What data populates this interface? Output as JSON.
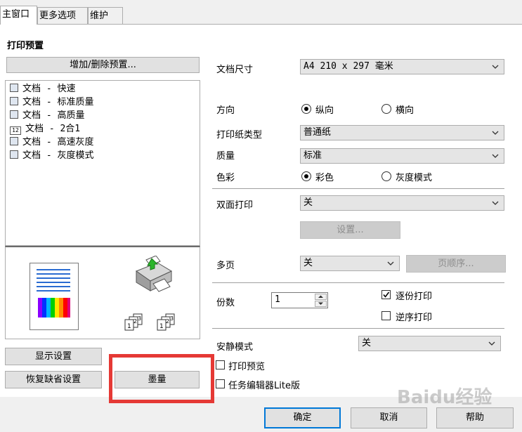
{
  "tabs": [
    "主窗口",
    "更多选项",
    "维护"
  ],
  "preset": {
    "title": "打印预置",
    "add_delete_button": "增加/删除预置...",
    "items": [
      {
        "label": "文档 - 快速",
        "icon": "document-icon"
      },
      {
        "label": "文档 - 标准质量",
        "icon": "document-icon"
      },
      {
        "label": "文档 - 高质量",
        "icon": "document-icon"
      },
      {
        "label": "文档 - 2合1",
        "icon": "two-in-one-icon",
        "badge": "12"
      },
      {
        "label": "文档 - 高速灰度",
        "icon": "document-icon"
      },
      {
        "label": "文档 - 灰度模式",
        "icon": "document-icon"
      }
    ]
  },
  "settings": {
    "doc_size_label": "文档尺寸",
    "doc_size_value": "A4 210 x 297 毫米",
    "orientation_label": "方向",
    "orientation_portrait": "纵向",
    "orientation_landscape": "横向",
    "paper_type_label": "打印纸类型",
    "paper_type_value": "普通纸",
    "quality_label": "质量",
    "quality_value": "标准",
    "color_label": "色彩",
    "color_color": "彩色",
    "color_grayscale": "灰度模式",
    "duplex_label": "双面打印",
    "duplex_value": "关",
    "duplex_settings_button": "设置...",
    "multipage_label": "多页",
    "multipage_value": "关",
    "page_order_button": "页顺序...",
    "copies_label": "份数",
    "copies_value": "1",
    "collate_label": "逐份打印",
    "reverse_label": "逆序打印",
    "quiet_mode_label": "安静模式",
    "quiet_mode_value": "关",
    "print_preview_label": "打印预览",
    "job_arranger_label": "任务编辑器Lite版"
  },
  "buttons": {
    "show_settings": "显示设置",
    "restore_defaults": "恢复缺省设置",
    "ink_levels": "墨量",
    "ok": "确定",
    "cancel": "取消",
    "help": "帮助"
  },
  "preview_copies_icons": [
    "1 2 3",
    "1 2 3"
  ],
  "colors": {
    "highlight_box": "#e53935",
    "accent": "#0078d7"
  },
  "watermark": "Baidu经验"
}
